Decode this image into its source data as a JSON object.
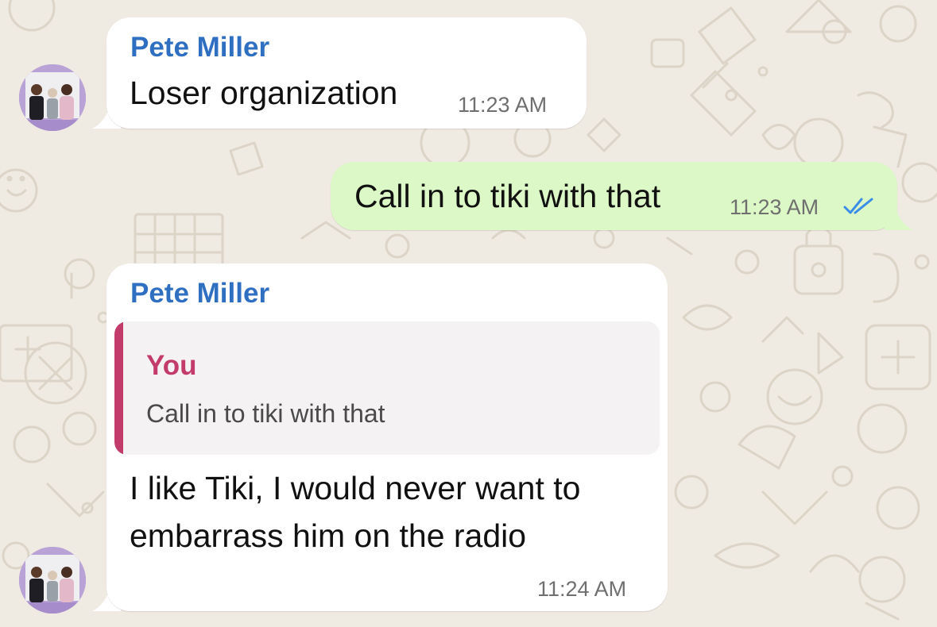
{
  "theme": {
    "wallpaper_color": "#efeae2",
    "incoming_bubble_color": "#ffffff",
    "outgoing_bubble_color": "#dcf8c6",
    "sender_name_color": "#2f6fc2",
    "quote_accent_color": "#c23b6a",
    "read_receipt_color": "#3b8ee8"
  },
  "chat": {
    "messages": [
      {
        "direction": "incoming",
        "sender": "Pete Miller",
        "text": "Loser organization",
        "time": "11:23 AM"
      },
      {
        "direction": "outgoing",
        "text": "Call in to tiki with that",
        "time": "11:23 AM",
        "status_icon": "double-check-read-icon"
      },
      {
        "direction": "incoming",
        "sender": "Pete Miller",
        "quoted": {
          "author": "You",
          "text": "Call in to tiki with that"
        },
        "text_lines": [
          "I like Tiki, I would never want to",
          "embarrass him on the radio"
        ],
        "time": "11:24 AM"
      }
    ]
  }
}
